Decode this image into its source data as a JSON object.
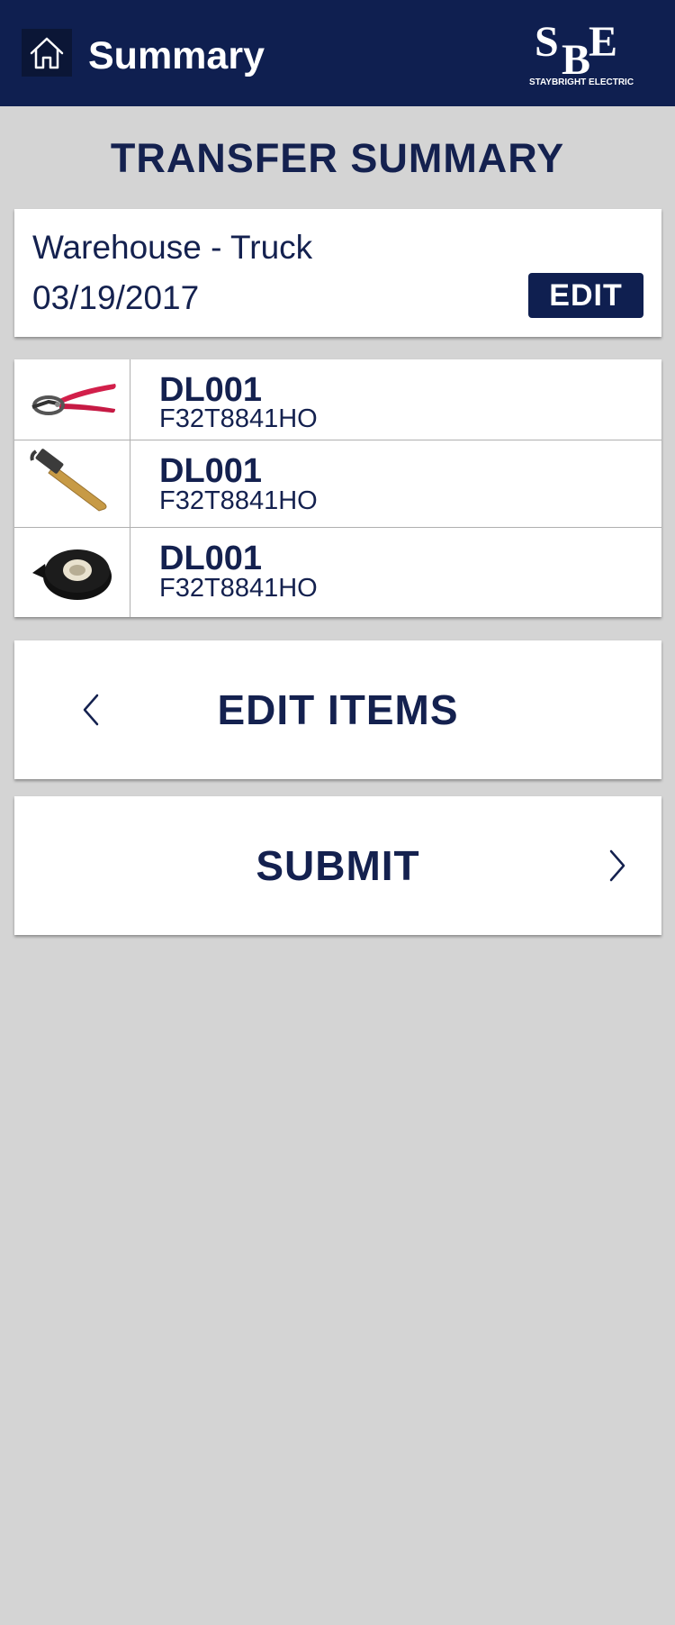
{
  "header": {
    "title": "Summary",
    "logo_letters": "SBE",
    "logo_text": "STAYBRIGHT ELECTRIC",
    "home_icon": "home-icon",
    "background": "#0f1f50"
  },
  "page": {
    "heading": "TRANSFER SUMMARY"
  },
  "transfer": {
    "route": "Warehouse - Truck",
    "date": "03/19/2017",
    "edit_label": "EDIT"
  },
  "items": [
    {
      "image": "wire-cutter-image",
      "code": "DL001",
      "part": "F32T8841HO"
    },
    {
      "image": "hammer-image",
      "code": "DL001",
      "part": "F32T8841HO"
    },
    {
      "image": "electrical-tape-image",
      "code": "DL001",
      "part": "F32T8841HO"
    }
  ],
  "actions": {
    "edit_items_label": "EDIT ITEMS",
    "submit_label": "SUBMIT"
  },
  "colors": {
    "accent": "#0f1f50",
    "text": "#14214f",
    "background": "#d4d4d4"
  }
}
